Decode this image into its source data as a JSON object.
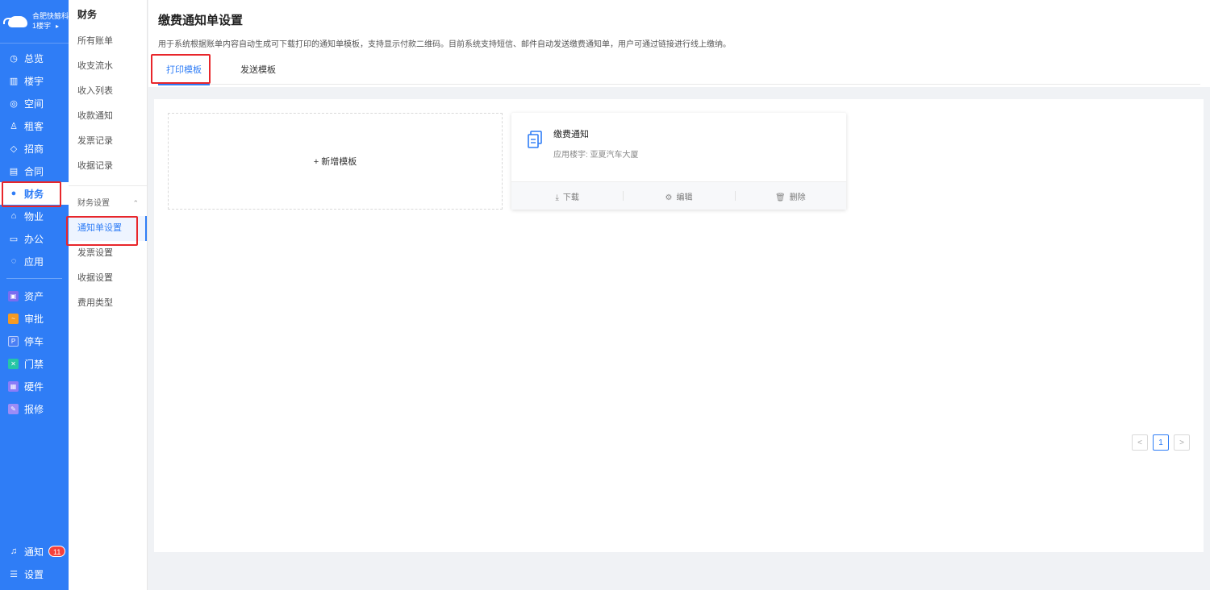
{
  "brand": {
    "line1": "合肥快鲸科",
    "line2": "1楼宇",
    "arrow": "▸"
  },
  "nav": {
    "items": [
      {
        "label": "总览",
        "icon": "◷"
      },
      {
        "label": "楼宇",
        "icon": "▥"
      },
      {
        "label": "空间",
        "icon": "◎"
      },
      {
        "label": "租客",
        "icon": "♙"
      },
      {
        "label": "招商",
        "icon": "◇"
      },
      {
        "label": "合同",
        "icon": "▤"
      },
      {
        "label": "财务",
        "icon": "●"
      },
      {
        "label": "物业",
        "icon": "⌂"
      },
      {
        "label": "办公",
        "icon": "▭"
      },
      {
        "label": "应用",
        "icon": "◌"
      }
    ],
    "apps": [
      {
        "label": "资产",
        "color": "#7b6cf0",
        "glyph": "▣"
      },
      {
        "label": "审批",
        "color": "#f59a23",
        "glyph": "~"
      },
      {
        "label": "停车",
        "color": "#4a7ff5",
        "glyph": "P"
      },
      {
        "label": "门禁",
        "color": "#26c6a6",
        "glyph": "✕"
      },
      {
        "label": "硬件",
        "color": "#8b7cf8",
        "glyph": "▦"
      },
      {
        "label": "报修",
        "color": "#9d8cf6",
        "glyph": "✎"
      }
    ],
    "notify_label": "通知",
    "notify_count": "11",
    "settings_label": "设置"
  },
  "subnav": {
    "title": "财务",
    "items": [
      "所有账单",
      "收支流水",
      "收入列表",
      "收款通知",
      "发票记录",
      "收据记录"
    ],
    "group_label": "财务设置",
    "group_items": [
      "通知单设置",
      "发票设置",
      "收据设置",
      "费用类型"
    ]
  },
  "page": {
    "title": "缴费通知单设置",
    "desc": "用于系统根据账单内容自动生成可下载打印的通知单模板，支持显示付款二维码。目前系统支持短信、邮件自动发送缴费通知单，用户可通过链接进行线上缴纳。",
    "tabs": [
      "打印模板",
      "发送模板"
    ]
  },
  "add_card": {
    "label": "+ 新增模板"
  },
  "template": {
    "name": "缴费通知",
    "sub": "应用楼宇: 亚夏汽车大厦",
    "actions": {
      "download": "下载",
      "edit": "编辑",
      "delete": "删除"
    }
  },
  "pager": {
    "prev": "<",
    "page": "1",
    "next": ">"
  },
  "colors": {
    "primary": "#2f7df6",
    "highlight": "#e8262b"
  }
}
